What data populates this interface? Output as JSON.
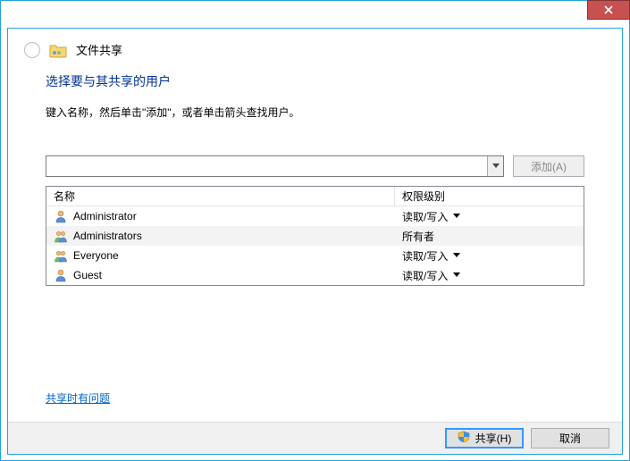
{
  "header": {
    "title": "文件共享"
  },
  "body": {
    "heading": "选择要与其共享的用户",
    "instruction": "键入名称，然后单击\"添加\"，或者单击箭头查找用户。",
    "input_value": "",
    "add_button": "添加(A)"
  },
  "list": {
    "columns": {
      "name": "名称",
      "perm": "权限级别"
    },
    "rows": [
      {
        "icon": "user",
        "name": "Administrator",
        "perm": "读取/写入",
        "has_caret": true,
        "selected": false
      },
      {
        "icon": "group",
        "name": "Administrators",
        "perm": "所有者",
        "has_caret": false,
        "selected": true
      },
      {
        "icon": "group",
        "name": "Everyone",
        "perm": "读取/写入",
        "has_caret": true,
        "selected": false
      },
      {
        "icon": "user",
        "name": "Guest",
        "perm": "读取/写入",
        "has_caret": true,
        "selected": false
      }
    ]
  },
  "help_link": "共享时有问题",
  "footer": {
    "share": "共享(H)",
    "cancel": "取消"
  }
}
